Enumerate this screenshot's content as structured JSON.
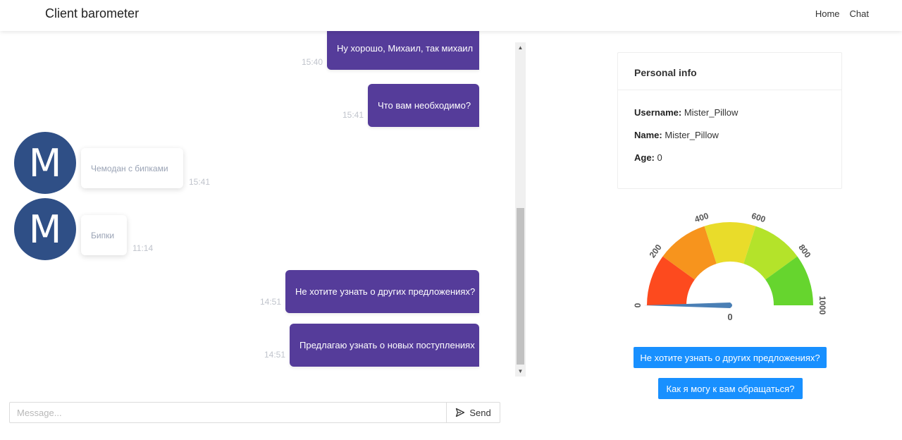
{
  "navbar": {
    "brand": "Client barometer",
    "links": [
      "Home",
      "Chat"
    ]
  },
  "chat": {
    "messages": [
      {
        "direction": "outgoing",
        "text": "Ну хорошо, Михаил, так михаил",
        "time": "15:40"
      },
      {
        "direction": "outgoing",
        "text": "Что вам необходимо?",
        "time": "15:41"
      },
      {
        "direction": "incoming",
        "avatar": "M",
        "text": "Чемодан с бипками",
        "time": "15:41"
      },
      {
        "direction": "incoming",
        "avatar": "M",
        "text": "Бипки",
        "time": "11:14"
      },
      {
        "direction": "outgoing",
        "text": "Не хотите узнать о других предложениях?",
        "time": "14:51"
      },
      {
        "direction": "outgoing",
        "text": "Предлагаю узнать о новых поступлениях",
        "time": "14:51"
      }
    ],
    "input_placeholder": "Message...",
    "input_value": "",
    "send_label": "Send"
  },
  "personal_info": {
    "title": "Personal info",
    "username_label": "Username:",
    "username": "Mister_Pillow",
    "name_label": "Name:",
    "name": "Mister_Pillow",
    "age_label": "Age:",
    "age": "0"
  },
  "gauge": {
    "min": 0,
    "max": 1000,
    "value": 0,
    "value_label": "0",
    "tick_labels": [
      "0",
      "200",
      "400",
      "600",
      "800",
      "1000"
    ],
    "band_colors": [
      "#fd4a1e",
      "#f7941d",
      "#e9dc2a",
      "#b4e32a",
      "#66d52e"
    ],
    "needle_color": "#4a7fb5"
  },
  "suggestions": [
    "Не хотите узнать о других предложениях?",
    "Как я могу к вам обращаться?"
  ],
  "colors": {
    "outgoing_bubble": "#553c9a",
    "avatar": "#2f4f86",
    "accent": "#1890ff"
  }
}
